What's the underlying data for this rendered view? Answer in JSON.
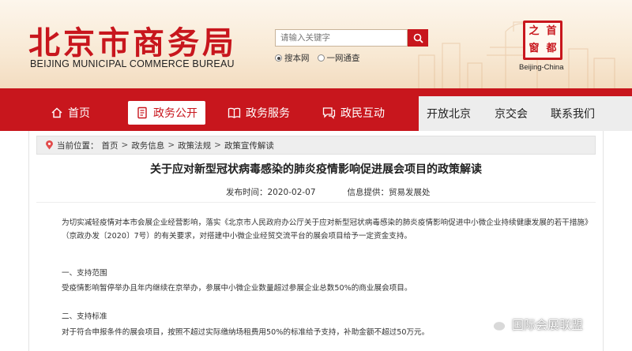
{
  "header": {
    "logo_cn": "北京市商务局",
    "logo_en": "BEIJING MUNICIPAL COMMERCE BUREAU",
    "search": {
      "placeholder": "请输入关键字"
    },
    "scope": {
      "option_site": "搜本网",
      "option_all": "一网通查",
      "selected": "option_site"
    },
    "seal": {
      "c1": "首",
      "c2": "之",
      "c3": "都",
      "c4": "窗"
    },
    "seal_caption": "Beijing-China"
  },
  "nav": {
    "items": [
      {
        "label": "首页",
        "icon": "home-icon"
      },
      {
        "label": "政务公开",
        "icon": "document-icon",
        "active": true
      },
      {
        "label": "政务服务",
        "icon": "book-icon"
      },
      {
        "label": "政民互动",
        "icon": "chat-icon"
      }
    ],
    "secondary": [
      "开放北京",
      "京交会",
      "联系我们"
    ]
  },
  "breadcrumb": {
    "prefix": "当前位置：",
    "items": [
      "首页",
      "政务信息",
      "政策法规",
      "政策宣传解读"
    ],
    "sep": ">"
  },
  "article": {
    "title": "关于应对新型冠状病毒感染的肺炎疫情影响促进展会项目的政策解读",
    "date_label": "发布时间：",
    "date": "2020-02-07",
    "source_label": "信息提供：",
    "source": "贸易发展处",
    "p1": "为切实减轻疫情对本市会展企业经营影响，落实《北京市人民政府办公厅关于应对新型冠状病毒感染的肺炎疫情影响促进中小微企业持续健康发展的若干措施》（京政办发〔2020〕7号）的有关要求，对搭建中小微企业经贸交流平台的展会项目给予一定资金支持。",
    "h1": "一、支持范围",
    "p2": "受疫情影响暂停举办且年内继续在京举办，参展中小微企业数量超过参展企业总数50%的商业展会项目。",
    "h2": "二、支持标准",
    "p3": "对于符合申报条件的展会项目，按照不超过实际缴纳场租费用50%的标准给予支持，补助金额不超过50万元。"
  },
  "watermark": "国际会展联盟",
  "colors": {
    "brand_red": "#c8161d",
    "nav_gray": "#ededed"
  }
}
